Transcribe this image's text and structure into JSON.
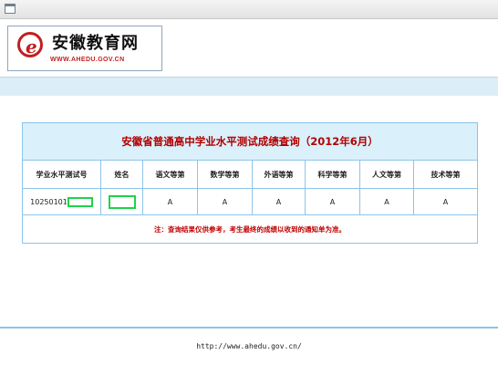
{
  "header": {
    "logo_title": "安徽教育网",
    "logo_url": "WWW.AHEDU.GOV.CN",
    "logo_letter": "e"
  },
  "table": {
    "caption": "安徽省普通高中学业水平测试成绩查询（2012年6月）",
    "columns": [
      "学业水平测试号",
      "姓名",
      "语文等第",
      "数学等第",
      "外语等第",
      "科学等第",
      "人文等第",
      "技术等第"
    ],
    "row": {
      "id_prefix": "10250101",
      "grades": [
        "A",
        "A",
        "A",
        "A",
        "A",
        "A"
      ]
    },
    "note": "注：查询结果仅供参考，考生最终的成绩以收到的通知单为准。"
  },
  "footer": {
    "url": "http://www.ahedu.gov.cn/"
  },
  "colors": {
    "caption_text": "#b00000",
    "border": "#8cc4ea",
    "band": "#dceef8",
    "mask": "#1fd24a"
  }
}
